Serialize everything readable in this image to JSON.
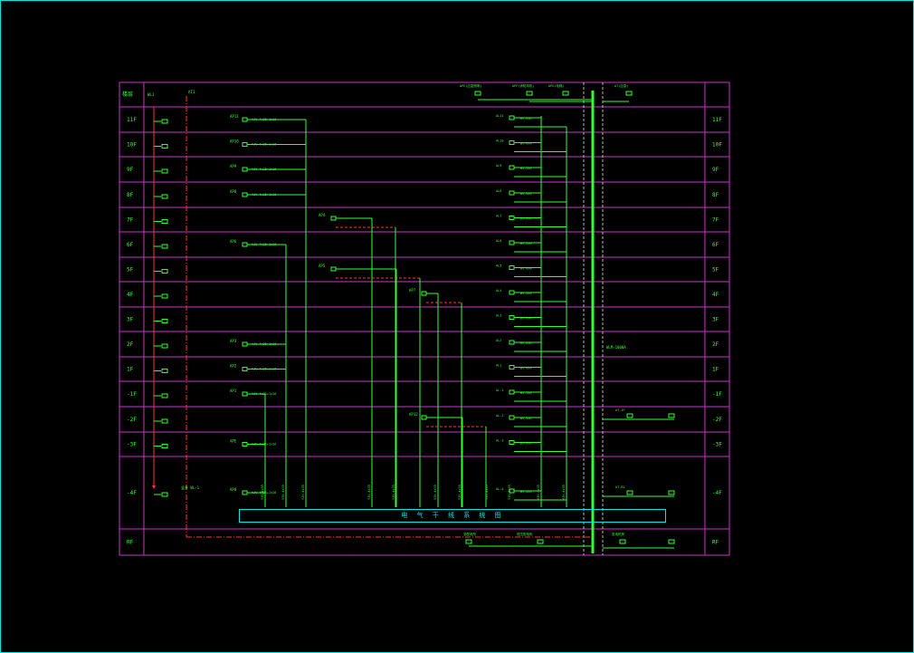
{
  "diagram": {
    "header_left": "楼层",
    "floors_left": [
      "11F",
      "10F",
      "9F",
      "8F",
      "7F",
      "6F",
      "5F",
      "4F",
      "3F",
      "2F",
      "1F",
      "-1F",
      "-2F",
      "-3F",
      "-4F",
      "RF"
    ],
    "floors_right": [
      "11F",
      "10F",
      "9F",
      "8F",
      "7F",
      "6F",
      "5F",
      "4F",
      "3F",
      "2F",
      "1F",
      "-1F",
      "-2F",
      "-3F",
      "-4F",
      "RF"
    ],
    "legend_text": "电 气 干 线 系 统 图",
    "colors": {
      "frame": "#00e5e5",
      "grid": "#cc33cc",
      "wire": "#33ff33",
      "busbar": "#33ff33",
      "riser": "#ff3333",
      "label": "#ffff33"
    },
    "panels_left": [
      {
        "name": "AP11",
        "spec": "YJV-4x35+1x16"
      },
      {
        "name": "AP10",
        "spec": "YJV-4x35+1x16"
      },
      {
        "name": "AP9",
        "spec": "YJV-4x35+1x16"
      },
      {
        "name": "AP8",
        "spec": "YJV-4x35+1x16"
      },
      {
        "name": "AP6",
        "spec": "YJV-4x35+1x16"
      },
      {
        "name": "AP3",
        "spec": "YJV-4x35+1x16"
      },
      {
        "name": "AP2",
        "spec": "YJV-4x35+1x16"
      },
      {
        "name": "AP1",
        "spec": "YJV-4x35+1x16"
      }
    ],
    "panels_right": [
      "AL11",
      "AL10",
      "AL9",
      "AL8",
      "AL7",
      "AL6",
      "AL5",
      "AL4",
      "AL3",
      "AL2",
      "AL1",
      "AL-1",
      "AL-2",
      "AL-3",
      "AL-4"
    ],
    "top_labels": [
      "APE(应急照明)",
      "APF(消防风机)",
      "APG(电梯)",
      "AT(应急)"
    ],
    "bottom_labels": [
      "变配电所",
      "低压配电柜",
      "发电机房"
    ],
    "riser_label": "竖井 WL-1"
  }
}
